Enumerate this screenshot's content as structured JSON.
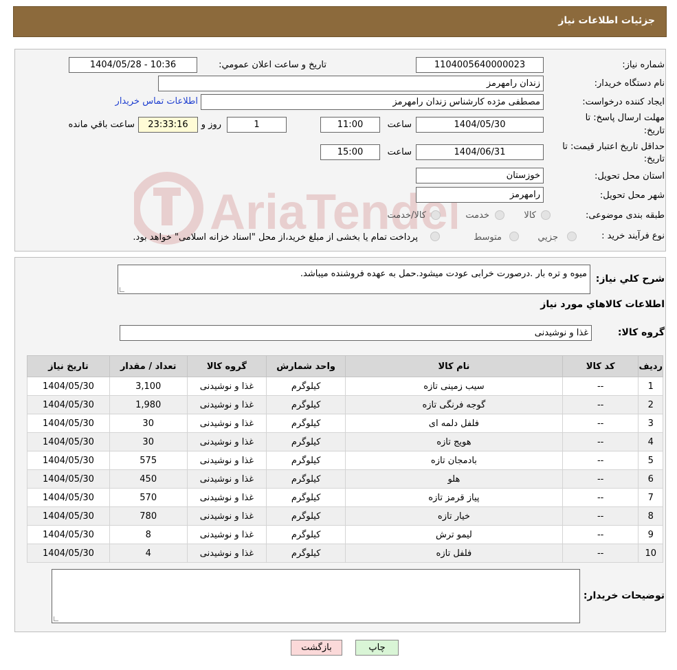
{
  "header": {
    "title": "جزئیات اطلاعات نیاز"
  },
  "form": {
    "need_number_label": "شماره نیاز:",
    "need_number": "1104005640000023",
    "announce_label": "تاريخ و ساعت اعلان عمومي:",
    "announce_value": "1404/05/28 - 10:36",
    "buyer_label": "نام دستگاه خريدار:",
    "buyer_value": "زندان رامهرمز",
    "creator_label": "ايجاد کننده درخواست:",
    "creator_value": "مصطفی مژده کارشناس زندان رامهرمز",
    "contact_link": "اطلاعات تماس خريدار",
    "deadline_label_1": "مهلت ارسال پاسخ: تا",
    "deadline_label_2": "تاريخ:",
    "deadline_date": "1404/05/30",
    "time_label": "ساعت",
    "deadline_time": "11:00",
    "days_value": "1",
    "days_label": "روز و",
    "remaining_value": "23:33:16",
    "remaining_label": "ساعت باقي مانده",
    "validity_label_1": "حداقل تاريخ اعتبار قيمت: تا",
    "validity_label_2": "تاريخ:",
    "validity_date": "1404/06/31",
    "validity_time": "15:00",
    "province_label": "استان محل تحويل:",
    "province_value": "خوزستان",
    "city_label": "شهر محل تحويل:",
    "city_value": "رامهرمز",
    "category_label": "طبقه بندی موضوعی:",
    "category_options": [
      "کالا",
      "خدمت",
      "کالا/خدمت"
    ],
    "process_label": "نوع فرآيند خريد :",
    "process_options": [
      "جزيي",
      "متوسط"
    ],
    "process_note": "پرداخت تمام يا بخشی از مبلغ خريد،از محل \"اسناد خزانه اسلامی\" خواهد بود."
  },
  "details": {
    "description_label": "شرح کلي نياز:",
    "description_value": "میوه و تره بار .درصورت خرابی عودت میشود.حمل به عهده فروشنده میباشد.",
    "items_title": "اطلاعات کالاهاي مورد نياز",
    "group_label": "گروه کالا:",
    "group_value": "غذا و نوشیدنی",
    "columns": [
      "رديف",
      "کد کالا",
      "نام کالا",
      "واحد شمارش",
      "گروه کالا",
      "تعداد / مقدار",
      "تاريخ نياز"
    ],
    "rows": [
      [
        "1",
        "--",
        "سیب زمینی تازه",
        "کیلوگرم",
        "غذا و نوشیدنی",
        "3,100",
        "1404/05/30"
      ],
      [
        "2",
        "--",
        "گوجه فرنگی تازه",
        "کیلوگرم",
        "غذا و نوشیدنی",
        "1,980",
        "1404/05/30"
      ],
      [
        "3",
        "--",
        "فلفل دلمه ای",
        "کیلوگرم",
        "غذا و نوشیدنی",
        "30",
        "1404/05/30"
      ],
      [
        "4",
        "--",
        "هویج تازه",
        "کیلوگرم",
        "غذا و نوشیدنی",
        "30",
        "1404/05/30"
      ],
      [
        "5",
        "--",
        "بادمجان تازه",
        "کیلوگرم",
        "غذا و نوشیدنی",
        "575",
        "1404/05/30"
      ],
      [
        "6",
        "--",
        "هلو",
        "کیلوگرم",
        "غذا و نوشیدنی",
        "450",
        "1404/05/30"
      ],
      [
        "7",
        "--",
        "پیاز قرمز تازه",
        "کیلوگرم",
        "غذا و نوشیدنی",
        "570",
        "1404/05/30"
      ],
      [
        "8",
        "--",
        "خیار تازه",
        "کیلوگرم",
        "غذا و نوشیدنی",
        "780",
        "1404/05/30"
      ],
      [
        "9",
        "--",
        "لیمو ترش",
        "کیلوگرم",
        "غذا و نوشیدنی",
        "8",
        "1404/05/30"
      ],
      [
        "10",
        "--",
        "فلفل تازه",
        "کیلوگرم",
        "غذا و نوشیدنی",
        "4",
        "1404/05/30"
      ]
    ],
    "buyer_notes_label": "توضيحات خريدار:",
    "buyer_notes_value": ""
  },
  "watermark": {
    "text": "AriaTender.neT"
  },
  "buttons": {
    "print": "چاپ",
    "back": "بازگشت"
  },
  "colors": {
    "header": "#8c6a3c",
    "link": "#1f3fd0",
    "print_button": "#d9f5d6",
    "back_button": "#fbd9d9"
  }
}
